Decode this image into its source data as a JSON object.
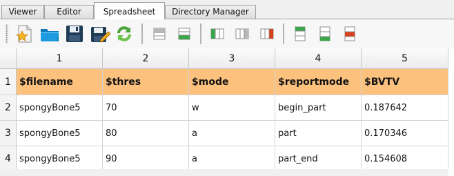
{
  "tabs": [
    {
      "label": "Viewer",
      "active": false
    },
    {
      "label": "Editor",
      "active": false
    },
    {
      "label": "Spreadsheet",
      "active": true
    },
    {
      "label": "Directory Manager",
      "active": false
    }
  ],
  "toolbar": {
    "buttons": [
      {
        "name": "new-file-icon"
      },
      {
        "name": "open-folder-icon"
      },
      {
        "name": "save-icon"
      },
      {
        "name": "save-as-icon"
      },
      {
        "name": "refresh-icon"
      },
      {
        "name": "insert-row-above-icon"
      },
      {
        "name": "insert-row-below-icon"
      },
      {
        "name": "insert-column-left-icon"
      },
      {
        "name": "insert-column-right-icon"
      },
      {
        "name": "delete-column-icon"
      },
      {
        "name": "insert-row-top-icon"
      },
      {
        "name": "insert-row-bottom-icon"
      },
      {
        "name": "delete-row-icon"
      }
    ]
  },
  "sheet": {
    "column_headers": [
      "1",
      "2",
      "3",
      "4",
      "5"
    ],
    "row_headers": [
      "1",
      "2",
      "3",
      "4"
    ],
    "rows": [
      [
        "$filename",
        "$thres",
        "$mode",
        "$reportmode",
        "$BVTV"
      ],
      [
        "spongyBone5",
        "70",
        "w",
        "begin_part",
        "0.187642"
      ],
      [
        "spongyBone5",
        "80",
        "a",
        "part",
        "0.170346"
      ],
      [
        "spongyBone5",
        "90",
        "a",
        "part_end",
        "0.154608"
      ]
    ],
    "header_row_color": "#fdc17e"
  }
}
